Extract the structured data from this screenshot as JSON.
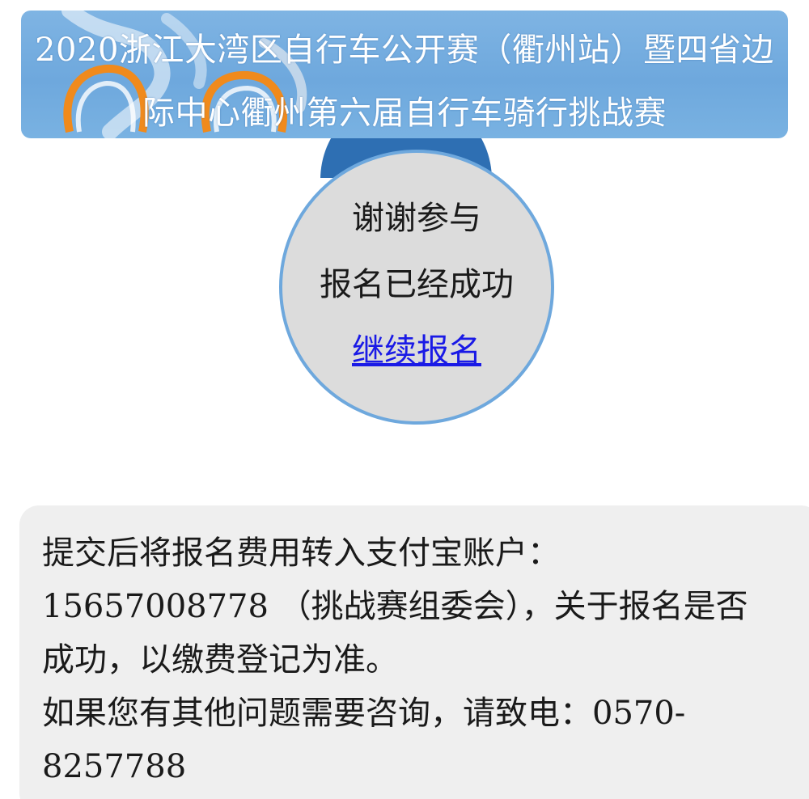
{
  "banner": {
    "title_line1": "2020浙江大湾区自行车公开赛（衢州站）暨四省边",
    "title_line2": "际中心衢州第六届自行车骑行挑战赛",
    "background_color": "#6ea8dd"
  },
  "result": {
    "thanks": "谢谢参与",
    "success": "报名已经成功",
    "continue_link": "继续报名",
    "link_color": "#1a1ae6"
  },
  "info": {
    "line1": "提交后将报名费用转入支付宝账户：",
    "line2": "15657008778 （挑战赛组委会），关于报名是否",
    "line3": "成功，以缴费登记为准。",
    "line4": "如果您有其他问题需要咨询，请致电：0570-",
    "line5": "8257788"
  }
}
